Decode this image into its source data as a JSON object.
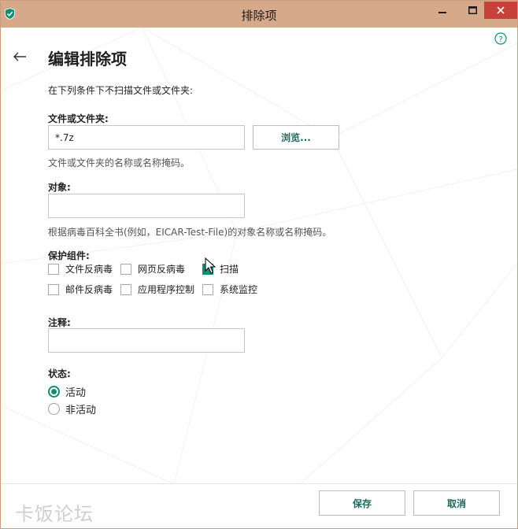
{
  "window": {
    "title": "排除项"
  },
  "page": {
    "title": "编辑排除项",
    "intro": "在下列条件下不扫描文件或文件夹:"
  },
  "file_field": {
    "label": "文件或文件夹:",
    "value": "*.7z",
    "browse_label": "浏览...",
    "hint": "文件或文件夹的名称或名称掩码。"
  },
  "object_field": {
    "label": "对象:",
    "value": "",
    "hint": "根据病毒百科全书(例如，EICAR-Test-File)的对象名称或名称掩码。"
  },
  "components": {
    "label": "保护组件:",
    "items": [
      {
        "label": "文件反病毒",
        "checked": false
      },
      {
        "label": "网页反病毒",
        "checked": false
      },
      {
        "label": "扫描",
        "checked": false
      },
      {
        "label": "邮件反病毒",
        "checked": false
      },
      {
        "label": "应用程序控制",
        "checked": false
      },
      {
        "label": "系统监控",
        "checked": false
      }
    ]
  },
  "comment_field": {
    "label": "注释:",
    "value": ""
  },
  "status": {
    "label": "状态:",
    "options": [
      {
        "label": "活动",
        "selected": true
      },
      {
        "label": "非活动",
        "selected": false
      }
    ]
  },
  "footer": {
    "save_label": "保存",
    "cancel_label": "取消",
    "watermark": "卡饭论坛"
  },
  "colors": {
    "titlebar": "#d5a98a",
    "accent": "#0f8f74",
    "close": "#c7413a"
  },
  "icons": {
    "app": "kaspersky-shield-icon",
    "help": "help-circle-icon",
    "back": "back-arrow-icon"
  }
}
